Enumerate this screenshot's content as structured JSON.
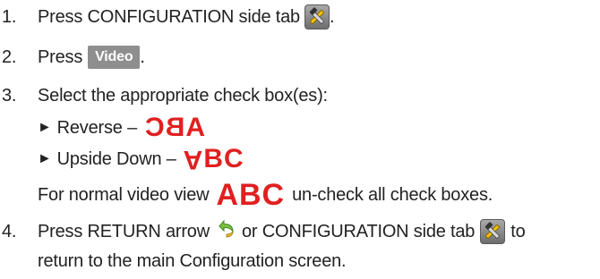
{
  "steps": [
    {
      "num": "1.",
      "text": "Press CONFIGURATION side tab",
      "after": "."
    },
    {
      "num": "2.",
      "text": "Press",
      "button": "Video",
      "after": "."
    },
    {
      "num": "3.",
      "text": "Select the appropriate check box(es):"
    },
    {
      "num": "4.",
      "text_a": "Press RETURN arrow",
      "text_b": "or CONFIGURATION side tab",
      "text_c": "to",
      "cont": "return to the main Configuration screen."
    }
  ],
  "options": [
    {
      "arrow": "►",
      "label": "Reverse –",
      "sample": "ABC"
    },
    {
      "arrow": "►",
      "label": "Upside Down –",
      "sample_a": "A",
      "sample_bc": "BC"
    }
  ],
  "note": {
    "before": "For normal video view",
    "sample": "ABC",
    "after": "un-check all check boxes."
  },
  "icons": {
    "config": "hammer-wrench-icon",
    "return": "return-arrow-icon"
  },
  "colors": {
    "sample_text": "#e02020",
    "button_bg": "#8e8e8e"
  }
}
